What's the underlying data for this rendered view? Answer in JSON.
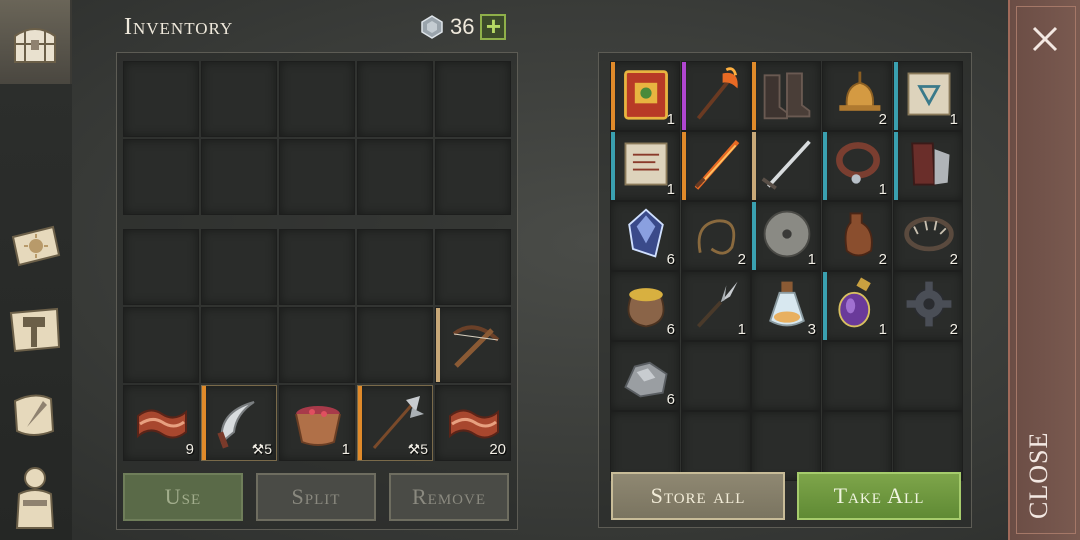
{
  "inventory": {
    "title": "Inventory",
    "currency_value": "36",
    "add_label": "+"
  },
  "player_items": [
    {
      "name": "bacon-icon",
      "qty": "9"
    },
    {
      "name": "sickle-icon",
      "durability": "5"
    },
    {
      "name": "berry-bowl-icon",
      "qty": "1"
    },
    {
      "name": "halberd-icon",
      "durability": "5"
    },
    {
      "name": "bacon-icon",
      "qty": "20"
    }
  ],
  "player_crossbow": {
    "name": "crossbow-icon"
  },
  "actions": {
    "use_label": "Use",
    "split_label": "Split",
    "remove_label": "Remove"
  },
  "storage_items": [
    {
      "name": "spellbook-icon",
      "qty": "1"
    },
    {
      "name": "fire-axe-icon",
      "qty": ""
    },
    {
      "name": "boots-icon",
      "qty": ""
    },
    {
      "name": "bell-icon",
      "qty": "2"
    },
    {
      "name": "blueprint-scroll-icon",
      "qty": "1"
    },
    {
      "name": "recipe-scroll-icon",
      "qty": "1"
    },
    {
      "name": "flame-sword-icon",
      "qty": ""
    },
    {
      "name": "steel-sword-icon",
      "qty": ""
    },
    {
      "name": "collar-icon",
      "qty": "1"
    },
    {
      "name": "gauntlet-icon",
      "qty": ""
    },
    {
      "name": "crystal-icon",
      "qty": "6"
    },
    {
      "name": "rope-icon",
      "qty": "2"
    },
    {
      "name": "whetstone-icon",
      "qty": "1"
    },
    {
      "name": "leather-flask-icon",
      "qty": "2"
    },
    {
      "name": "bear-trap-icon",
      "qty": "2"
    },
    {
      "name": "coin-sack-icon",
      "qty": "6"
    },
    {
      "name": "fork-blade-icon",
      "qty": "1"
    },
    {
      "name": "potion-icon",
      "qty": "3"
    },
    {
      "name": "purple-potion-icon",
      "qty": "1"
    },
    {
      "name": "gear-icon",
      "qty": "2"
    },
    {
      "name": "silver-ore-icon",
      "qty": "6"
    }
  ],
  "storage_actions": {
    "store_all_label": "Store all",
    "take_all_label": "Take All"
  },
  "close": {
    "label": "CLOSE"
  },
  "colors": {
    "rarity_orange": "#e08a2a",
    "rarity_purple": "#b046d0",
    "rarity_teal": "#3aa0b0",
    "take_all": "#6f9a40",
    "close_panel": "#6b4d45"
  }
}
